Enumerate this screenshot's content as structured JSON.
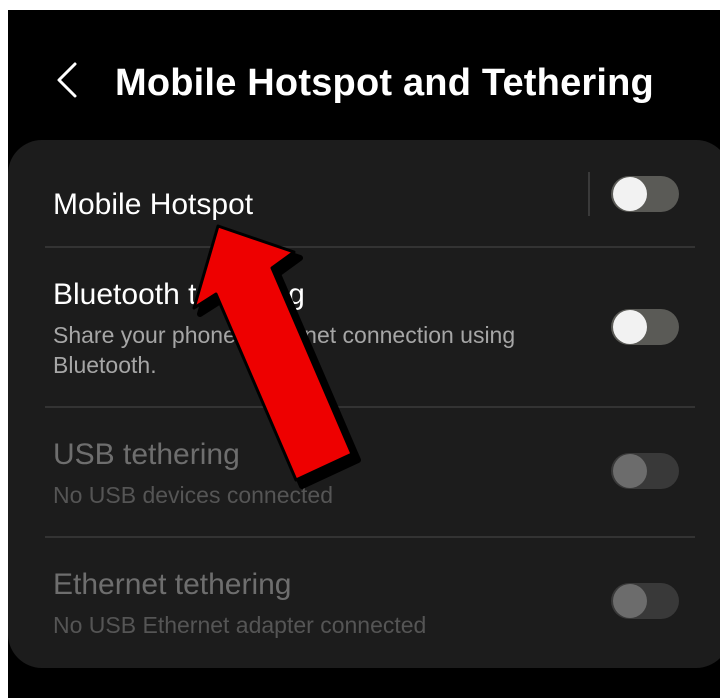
{
  "header": {
    "back_icon": "chevron-left-icon",
    "title": "Mobile Hotspot and Tethering"
  },
  "settings": [
    {
      "label": "Mobile Hotspot",
      "subtitle": "",
      "enabled": true,
      "on": false
    },
    {
      "label": "Bluetooth tethering",
      "subtitle": "Share your phone's Internet connection using Bluetooth.",
      "enabled": true,
      "on": false
    },
    {
      "label": "USB tethering",
      "subtitle": "No USB devices connected",
      "enabled": false,
      "on": false
    },
    {
      "label": "Ethernet tethering",
      "subtitle": "No USB Ethernet adapter connected",
      "enabled": false,
      "on": false
    }
  ],
  "annotation": {
    "icon": "red-arrow-icon",
    "color": "#ee0000"
  }
}
